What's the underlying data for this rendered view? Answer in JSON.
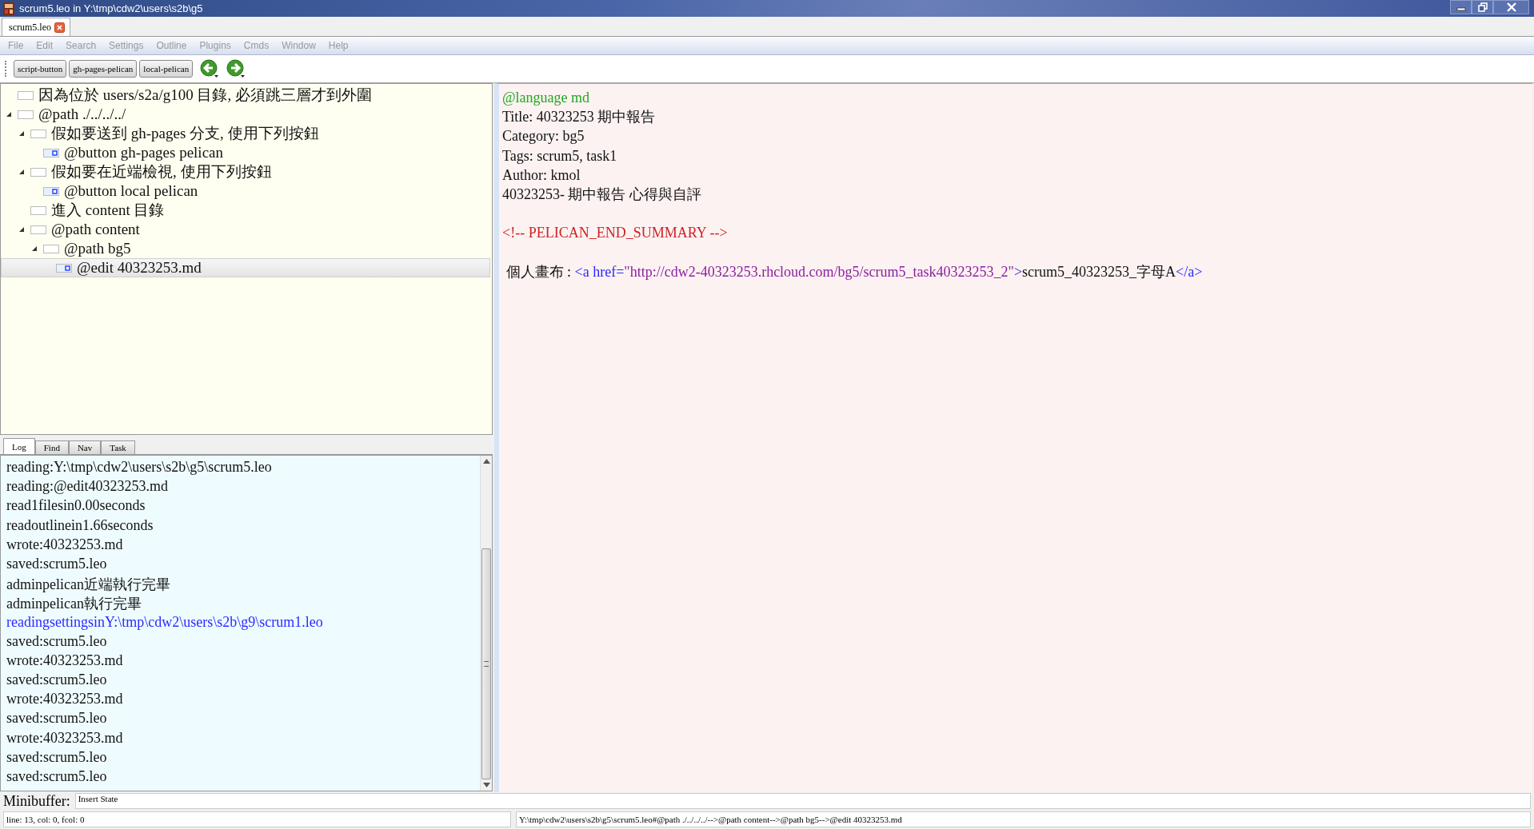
{
  "window": {
    "title": "scrum5.leo in Y:\\tmp\\cdw2\\users\\s2b\\g5"
  },
  "doc_tabs": [
    {
      "label": "scrum5.leo",
      "selected": true
    }
  ],
  "menu": [
    "File",
    "Edit",
    "Search",
    "Settings",
    "Outline",
    "Plugins",
    "Cmds",
    "Window",
    "Help"
  ],
  "toolbar": {
    "buttons": [
      "script-button",
      "gh-pages-pelican",
      "local-pelican"
    ]
  },
  "tree": [
    {
      "label": "因為位於 users/s2a/g100 目錄, 必須跳三層才到外圍",
      "kind": "plain",
      "selected": false
    },
    {
      "label": "@path ./../../../",
      "kind": "plain",
      "selected": false,
      "expanded": true,
      "children": [
        {
          "label": "假如要送到 gh-pages 分支, 使用下列按鈕",
          "kind": "plain",
          "selected": false,
          "expanded": true,
          "children": [
            {
              "label": "@button gh-pages pelican",
              "kind": "body",
              "selected": false
            }
          ]
        },
        {
          "label": "假如要在近端檢視, 使用下列按鈕",
          "kind": "plain",
          "selected": false,
          "expanded": true,
          "children": [
            {
              "label": "@button local pelican",
              "kind": "body",
              "selected": false
            }
          ]
        },
        {
          "label": "進入 content 目錄",
          "kind": "plain",
          "selected": false
        },
        {
          "label": "@path content",
          "kind": "plain",
          "selected": false,
          "expanded": true,
          "children": [
            {
              "label": "@path bg5",
              "kind": "plain",
              "selected": false,
              "expanded": true,
              "children": [
                {
                  "label": "@edit 40323253.md",
                  "kind": "body",
                  "selected": true
                }
              ]
            }
          ]
        }
      ]
    }
  ],
  "log_tabs": [
    {
      "label": "Log",
      "selected": true
    },
    {
      "label": "Find",
      "selected": false
    },
    {
      "label": "Nav",
      "selected": false
    },
    {
      "label": "Task",
      "selected": false
    }
  ],
  "log": [
    {
      "text": "reading:Y:\\tmp\\cdw2\\users\\s2b\\g5\\scrum5.leo",
      "kind": "normal"
    },
    {
      "text": "reading:@edit40323253.md",
      "kind": "normal"
    },
    {
      "text": "read1filesin0.00seconds",
      "kind": "normal"
    },
    {
      "text": "readoutlinein1.66seconds",
      "kind": "normal"
    },
    {
      "text": "wrote:40323253.md",
      "kind": "normal"
    },
    {
      "text": "saved:scrum5.leo",
      "kind": "normal"
    },
    {
      "text": "adminpelican近端執行完畢",
      "kind": "normal"
    },
    {
      "text": "adminpelican執行完畢",
      "kind": "normal"
    },
    {
      "text": "readingsettingsinY:\\tmp\\cdw2\\users\\s2b\\g9\\scrum1.leo",
      "kind": "settings"
    },
    {
      "text": "saved:scrum5.leo",
      "kind": "normal"
    },
    {
      "text": "wrote:40323253.md",
      "kind": "normal"
    },
    {
      "text": "saved:scrum5.leo",
      "kind": "normal"
    },
    {
      "text": "wrote:40323253.md",
      "kind": "normal"
    },
    {
      "text": "saved:scrum5.leo",
      "kind": "normal"
    },
    {
      "text": "wrote:40323253.md",
      "kind": "normal"
    },
    {
      "text": "saved:scrum5.leo",
      "kind": "normal"
    },
    {
      "text": "saved:scrum5.leo",
      "kind": "normal"
    }
  ],
  "editor": [
    {
      "blank_before": false,
      "segments": [
        {
          "text": "@language md",
          "kind": "directive"
        }
      ]
    },
    {
      "blank_before": false,
      "segments": [
        {
          "text": "Title: 40323253 期中報告",
          "kind": "text"
        }
      ]
    },
    {
      "blank_before": false,
      "segments": [
        {
          "text": "Category: bg5",
          "kind": "text"
        }
      ]
    },
    {
      "blank_before": false,
      "segments": [
        {
          "text": "Tags: scrum5, task1",
          "kind": "text"
        }
      ]
    },
    {
      "blank_before": false,
      "segments": [
        {
          "text": "Author: kmol",
          "kind": "text"
        }
      ]
    },
    {
      "blank_before": false,
      "segments": [
        {
          "text": "40323253- 期中報告 心得與自評",
          "kind": "text"
        }
      ]
    },
    {
      "blank_before": true,
      "segments": [
        {
          "text": "<!-- PELICAN_END_SUMMARY -->",
          "kind": "comment"
        }
      ]
    },
    {
      "blank_before": true,
      "segments": [
        {
          "text": " 個人畫布 : ",
          "kind": "text"
        },
        {
          "text": "<a href=",
          "kind": "tag"
        },
        {
          "text": "\"http://cdw2-40323253.rhcloud.com/bg5/scrum5_task40323253_2\"",
          "kind": "string"
        },
        {
          "text": ">",
          "kind": "tag"
        },
        {
          "text": "scrum5_40323253_字母A",
          "kind": "text"
        },
        {
          "text": "</a>",
          "kind": "tag"
        }
      ]
    }
  ],
  "minibuffer": {
    "label": "Minibuffer:",
    "value": "Insert State"
  },
  "status_bar": {
    "position": "line: 13, col: 0, fcol: 0",
    "path": "Y:\\tmp\\cdw2\\users\\s2b\\g5\\scrum5.leo#@path ./../../../-->@path content-->@path bg5-->@edit 40323253.md"
  }
}
